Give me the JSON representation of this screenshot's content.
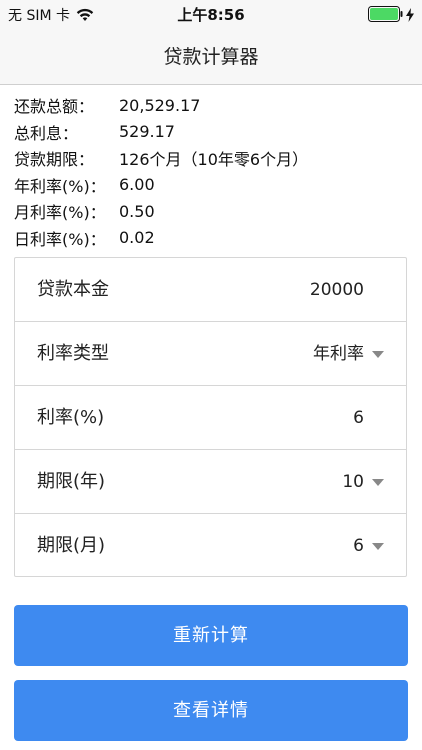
{
  "status_bar": {
    "carrier": "无 SIM 卡",
    "time": "上午8:56",
    "battery_icon": "battery-full-icon",
    "wifi_icon": "wifi-icon",
    "charging_icon": "charging-bolt-icon"
  },
  "nav": {
    "title": "贷款计算器"
  },
  "summary": {
    "total_repay_label": "还款总额：",
    "total_repay_value": "20,529.17",
    "total_interest_label": "总利息：",
    "total_interest_value": "529.17",
    "term_label": "贷款期限：",
    "term_value": "126个月（10年零6个月）",
    "annual_rate_label": "年利率(%)：",
    "annual_rate_value": "6.00",
    "monthly_rate_label": "月利率(%)：",
    "monthly_rate_value": "0.50",
    "daily_rate_label": "日利率(%)：",
    "daily_rate_value": "0.02"
  },
  "form": {
    "principal_label": "贷款本金",
    "principal_value": "20000",
    "rate_type_label": "利率类型",
    "rate_type_value": "年利率",
    "rate_label": "利率(%)",
    "rate_value": "6",
    "years_label": "期限(年)",
    "years_value": "10",
    "months_label": "期限(月)",
    "months_value": "6"
  },
  "buttons": {
    "recalculate": "重新计算",
    "details": "查看详情"
  },
  "colors": {
    "primary": "#3e8af0",
    "battery": "#4cd964"
  }
}
